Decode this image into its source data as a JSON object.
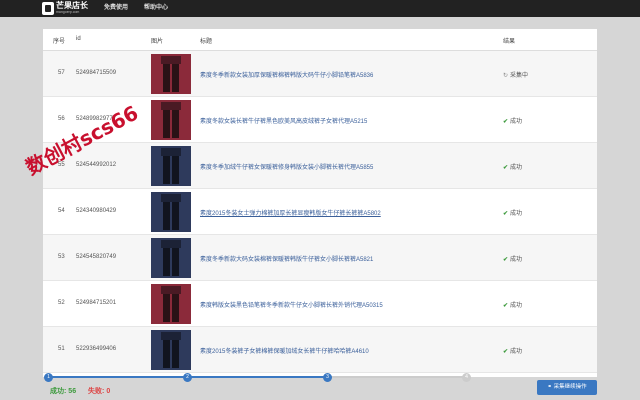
{
  "topbar": {
    "logo_text": "芒果店长",
    "logo_sub": "mangoerp.com",
    "nav": [
      "免费使用",
      "帮助中心"
    ]
  },
  "table": {
    "headers": [
      "序号",
      "id",
      "图片",
      "标题",
      "结果"
    ],
    "rows": [
      {
        "seq": "57",
        "id": "524984715509",
        "title": "素度冬季新款女装加厚保暖裤棉裤韩版大码牛仔小脚铅笔裤A5836",
        "result": "采集中",
        "status": "pending",
        "thumb": "dark-red"
      },
      {
        "seq": "56",
        "id": "524899829777",
        "title": "素度冬款女装长裤牛仔裤黑色欧美风高皮绒裤子女裤代理A5215",
        "result": "成功",
        "status": "ok",
        "thumb": "dark-red"
      },
      {
        "seq": "55",
        "id": "524544992012",
        "title": "素度冬季加绒牛仔裤女保暖裤修身韩版女装小脚裤长裤代理A5855",
        "result": "成功",
        "status": "ok",
        "thumb": "navy"
      },
      {
        "seq": "54",
        "id": "524340980429",
        "title": "素度2015冬装女士弹力棉裤加厚长裤显瘦韩版女牛仔裤长裤裤A5802",
        "result": "成功",
        "status": "ok",
        "thumb": "navy",
        "underline": true
      },
      {
        "seq": "53",
        "id": "524545820749",
        "title": "素度冬季新款大码女装棉裤保暖裤韩版牛仔裤女小脚长裤裤A5821",
        "result": "成功",
        "status": "ok",
        "thumb": "navy"
      },
      {
        "seq": "52",
        "id": "524984715201",
        "title": "素度韩版女装黑色铅笔裤冬季新款牛仔女小脚裤长裤外销代理A50315",
        "result": "成功",
        "status": "ok",
        "thumb": "dark-red"
      },
      {
        "seq": "51",
        "id": "522936499406",
        "title": "素度2015冬装裤子女裤棉裤保暖加绒女长裤牛仔裤哈哈裤A4610",
        "result": "成功",
        "status": "ok",
        "thumb": "navy"
      }
    ]
  },
  "watermark": "数创村scs66",
  "progress": {
    "steps": [
      "1",
      "2",
      "3",
      "4"
    ],
    "current_step": 3,
    "accent": "#3a78c2"
  },
  "footer": {
    "success_label": "成功:",
    "success_count": "56",
    "fail_label": "失败:",
    "fail_count": "0",
    "button_label": "采集继续操作"
  },
  "icons": {
    "ok": "check-icon",
    "pending": "spinner-icon"
  }
}
